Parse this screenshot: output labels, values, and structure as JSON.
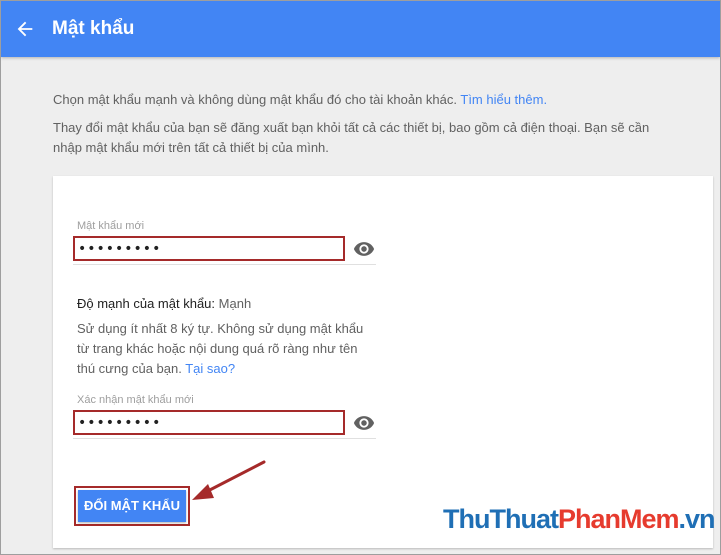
{
  "header": {
    "title": "Mật khẩu",
    "back_icon": "arrow-back-icon",
    "color": "#4285f4"
  },
  "intro": {
    "line1": "Chọn mật khẩu mạnh và không dùng mật khẩu đó cho tài khoản khác.",
    "learn_more": "Tìm hiểu thêm.",
    "line2": "Thay đổi mật khẩu của bạn sẽ đăng xuất bạn khỏi tất cả các thiết bị, bao gồm cả điện thoại. Bạn sẽ cần nhập mật khẩu mới trên tất cả thiết bị của mình."
  },
  "form": {
    "new_password": {
      "label": "Mật khẩu mới",
      "value": "•••••••••",
      "toggle_icon": "eye-icon"
    },
    "strength": {
      "label": "Độ mạnh của mật khẩu:",
      "value": "Mạnh"
    },
    "advice": "Sử dụng ít nhất 8 ký tự. Không sử dụng mật khẩu từ trang khác hoặc nội dung quá rõ ràng như tên thú cưng của bạn.",
    "why_link": "Tại sao?",
    "confirm_password": {
      "label": "Xác nhận mật khẩu mới",
      "value": "•••••••••",
      "toggle_icon": "eye-icon"
    },
    "submit_label": "ĐỔI MẬT KHẨU"
  },
  "annotation": {
    "highlight_color": "#a52a2a"
  },
  "watermark": {
    "part1": "ThuThuat",
    "part2": "PhanMem",
    "part3": ".vn"
  }
}
